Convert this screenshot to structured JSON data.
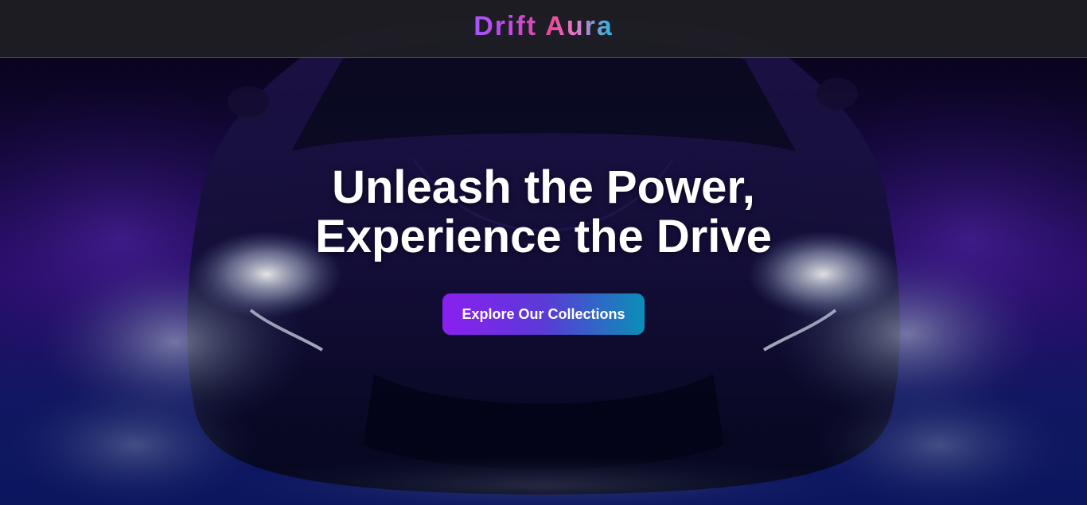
{
  "brand": {
    "logo_text": "Drift Aura"
  },
  "hero": {
    "headline_line1": "Unleash the Power,",
    "headline_line2": "Experience the Drive",
    "cta_label": "Explore Our Collections",
    "background_image": "car-front-headlights-smoke"
  },
  "colors": {
    "nav_bg": "#1e1e24",
    "logo_gradient_start": "#a855f7",
    "logo_gradient_mid": "#ec4899",
    "logo_gradient_end": "#22b8e0",
    "cta_gradient_start": "#8b1ff0",
    "cta_gradient_end": "#0a8fb8",
    "hero_bg_top": "#07041a",
    "hero_bg_mid": "#2a0d6e",
    "hero_bg_bottom": "#0d1a70"
  }
}
